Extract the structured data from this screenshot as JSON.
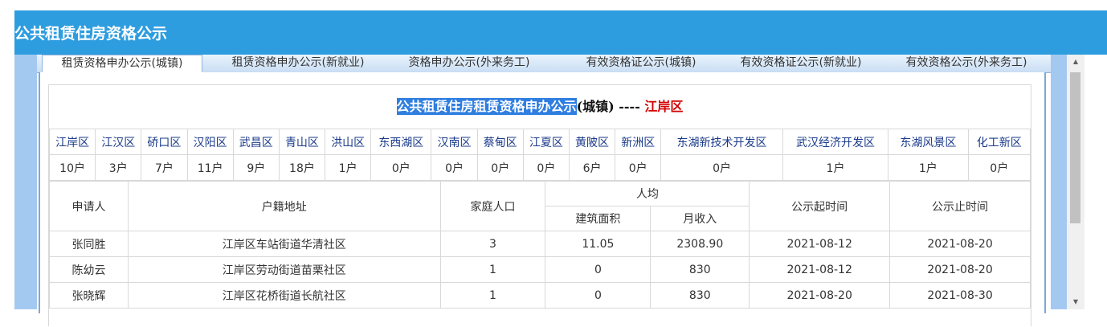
{
  "header": {
    "title": "公共租赁住房资格公示"
  },
  "tabs": [
    {
      "label": "租赁资格申办公示(城镇)",
      "active": true
    },
    {
      "label": "租赁资格申办公示(新就业)",
      "active": false
    },
    {
      "label": "资格申办公示(外来务工)",
      "active": false
    },
    {
      "label": "有效资格证公示(城镇)",
      "active": false
    },
    {
      "label": "有效资格证公示(新就业)",
      "active": false
    },
    {
      "label": "有效资格公示(外来务工)",
      "active": false
    }
  ],
  "panel": {
    "title_highlight": "公共租赁住房租赁资格申办公示",
    "title_suffix": "(城镇) ---- ",
    "title_district": "江岸区"
  },
  "districts": [
    {
      "name": "江岸区",
      "count": "10户"
    },
    {
      "name": "江汉区",
      "count": "3户"
    },
    {
      "name": "硚口区",
      "count": "7户"
    },
    {
      "name": "汉阳区",
      "count": "11户"
    },
    {
      "name": "武昌区",
      "count": "9户"
    },
    {
      "name": "青山区",
      "count": "18户"
    },
    {
      "name": "洪山区",
      "count": "1户"
    },
    {
      "name": "东西湖区",
      "count": "0户"
    },
    {
      "name": "汉南区",
      "count": "0户"
    },
    {
      "name": "蔡甸区",
      "count": "0户"
    },
    {
      "name": "江夏区",
      "count": "0户"
    },
    {
      "name": "黄陂区",
      "count": "6户"
    },
    {
      "name": "新洲区",
      "count": "0户"
    },
    {
      "name": "东湖新技术开发区",
      "count": "0户"
    },
    {
      "name": "武汉经济开发区",
      "count": "1户"
    },
    {
      "name": "东湖风景区",
      "count": "1户"
    },
    {
      "name": "化工新区",
      "count": "0户"
    }
  ],
  "table": {
    "headers": {
      "applicant": "申请人",
      "address": "户籍地址",
      "household": "家庭人口",
      "per_capita": "人均",
      "area": "建筑面积",
      "income": "月收入",
      "start": "公示起时间",
      "end": "公示止时间"
    },
    "rows": [
      {
        "applicant": "张同胜",
        "address": "江岸区车站街道华清社区",
        "household": "3",
        "area": "11.05",
        "income": "2308.90",
        "start": "2021-08-12",
        "end": "2021-08-20"
      },
      {
        "applicant": "陈幼云",
        "address": "江岸区劳动街道苗栗社区",
        "household": "1",
        "area": "0",
        "income": "830",
        "start": "2021-08-12",
        "end": "2021-08-20"
      },
      {
        "applicant": "张晓辉",
        "address": "江岸区花桥街道长航社区",
        "household": "1",
        "area": "0",
        "income": "830",
        "start": "2021-08-20",
        "end": "2021-08-30"
      }
    ]
  },
  "scrollbar": {
    "up_icon": "triangle-up",
    "down_icon": "triangle-down"
  },
  "colors": {
    "header_bg": "#2d9ddf",
    "highlight": "#2f7ee0",
    "district_red": "#d40000"
  }
}
